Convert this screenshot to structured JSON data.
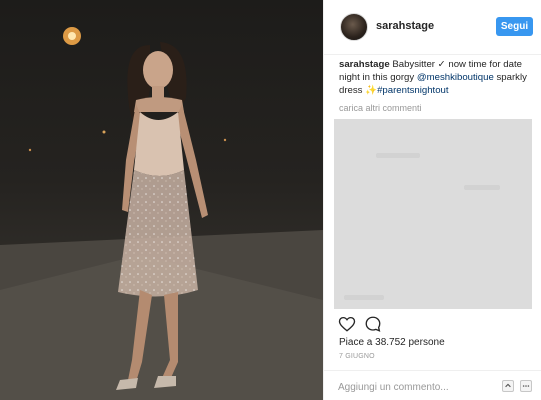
{
  "post": {
    "username": "sarahstage",
    "follow_label": "Segui",
    "caption": {
      "username": "sarahstage",
      "text_part1": " Babysitter ✓ now time for date night in this gorgy ",
      "mention": "@meshkiboutique",
      "text_part2": " sparkly dress ✨",
      "hashtag": "#parentsnightout"
    },
    "more_comments_label": "carica altri commenti",
    "likes_label": "Piace a 38.752 persone",
    "date_label": "7 GIUGNO",
    "comment_placeholder": "Aggiungi un commento..."
  },
  "icons": {
    "like": "heart-icon",
    "comment": "comment-icon",
    "scroll_up": "chevron-up-icon",
    "options": "ellipsis-icon"
  },
  "colors": {
    "accent": "#3897f0",
    "link": "#003569",
    "muted": "#999999"
  }
}
